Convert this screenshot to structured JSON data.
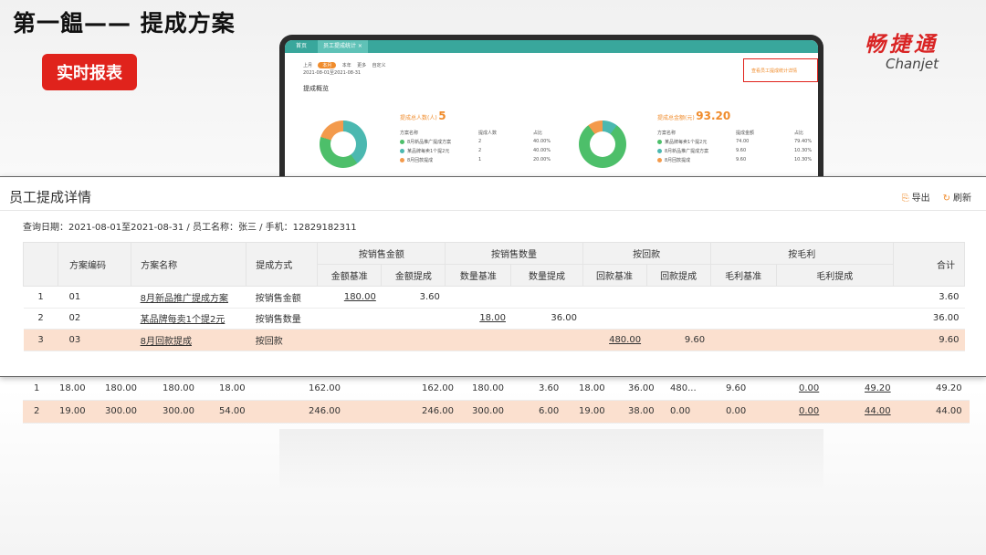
{
  "slide": {
    "title": "第一饂—— 提成方案",
    "badge": "实时报表"
  },
  "brand": {
    "cn": "畅捷通",
    "en": "Chanjet"
  },
  "monitor": {
    "tabs": [
      "首页",
      "员工提成统计 ×"
    ],
    "periods": [
      "上月",
      "本月",
      "本年",
      "更多",
      "自定义"
    ],
    "date_range": "2021-08-01至2021-08-31",
    "section": "提成概览",
    "top_button": "查看员工提成统计详情",
    "left_stat": {
      "label": "提成总人数(人)",
      "value": "5"
    },
    "right_stat": {
      "label": "提成总金额(元)",
      "value": "93.20"
    },
    "left_header": [
      "方案名称",
      "提成人数",
      "占比"
    ],
    "right_header": [
      "方案名称",
      "提成金额",
      "占比"
    ],
    "left_rows": [
      {
        "name": "8月新品推广提成方案",
        "num": "2",
        "pct": "40.00%",
        "color": "#4dbf6a"
      },
      {
        "name": "某品牌每卖1个提2元",
        "num": "2",
        "pct": "40.00%",
        "color": "#4bb8b0"
      },
      {
        "name": "8月回款提成",
        "num": "1",
        "pct": "20.00%",
        "color": "#f39a4c"
      }
    ],
    "right_rows": [
      {
        "name": "某品牌每卖1个提2元",
        "num": "74.00",
        "pct": "79.40%",
        "color": "#4dbf6a"
      },
      {
        "name": "8月新品推广提成方案",
        "num": "9.60",
        "pct": "10.30%",
        "color": "#4bb8b0"
      },
      {
        "name": "8月回款提成",
        "num": "9.60",
        "pct": "10.30%",
        "color": "#f39a4c"
      }
    ]
  },
  "panel": {
    "title": "员工提成详情",
    "export": "导出",
    "refresh": "刷新",
    "query": "查询日期：2021-08-01至2021-08-31 / 员工名称：张三 / 手机：12829182311",
    "group_headers": [
      "按销售金额",
      "按销售数量",
      "按回款",
      "按毛利"
    ],
    "headers": {
      "code": "方案编码",
      "name": "方案名称",
      "method": "提成方式",
      "total": "合计"
    },
    "sub_headers": [
      "金额基准",
      "金额提成",
      "数量基准",
      "数量提成",
      "回款基准",
      "回款提成",
      "毛利基准",
      "毛利提成"
    ],
    "rows": [
      {
        "idx": "1",
        "code": "01",
        "name": "8月新品推广提成方案",
        "method": "按销售金额",
        "amt_base": "180.00",
        "amt_comm": "3.60",
        "qty_base": "",
        "qty_comm": "",
        "ret_base": "",
        "ret_comm": "",
        "gp_base": "",
        "gp_comm": "",
        "total": "3.60"
      },
      {
        "idx": "2",
        "code": "02",
        "name": "某品牌每卖1个提2元",
        "method": "按销售数量",
        "amt_base": "",
        "amt_comm": "",
        "qty_base": "18.00",
        "qty_comm": "36.00",
        "ret_base": "",
        "ret_comm": "",
        "gp_base": "",
        "gp_comm": "",
        "total": "36.00"
      },
      {
        "idx": "3",
        "code": "03",
        "name": "8月回款提成",
        "method": "按回款",
        "amt_base": "",
        "amt_comm": "",
        "qty_base": "",
        "qty_comm": "",
        "ret_base": "480.00",
        "ret_comm": "9.60",
        "gp_base": "",
        "gp_comm": "",
        "total": "9.60"
      }
    ]
  },
  "bottom_rows": [
    [
      "1",
      "18.00",
      "180.00",
      "180.00",
      "18.00",
      "162.00",
      "162.00",
      "180.00",
      "3.60",
      "18.00",
      "36.00",
      "480...",
      "9.60",
      "0.00",
      "49.20",
      "49.20"
    ],
    [
      "2",
      "19.00",
      "300.00",
      "300.00",
      "54.00",
      "246.00",
      "246.00",
      "300.00",
      "6.00",
      "19.00",
      "38.00",
      "0.00",
      "0.00",
      "0.00",
      "44.00",
      "44.00"
    ]
  ]
}
